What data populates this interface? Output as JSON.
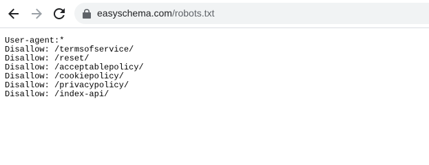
{
  "browser": {
    "icons": {
      "back": "arrow-left-icon",
      "forward": "arrow-right-icon",
      "reload": "reload-icon",
      "lock": "lock-icon"
    },
    "url_host": "easyschema.com",
    "url_path": "/robots.txt",
    "colors": {
      "omnibox_bg": "#f1f3f4",
      "icon_active": "#5f6368",
      "icon_disabled": "#9aa0a6"
    }
  },
  "document": {
    "lines": [
      "User-agent:*",
      "Disallow: /termsofservice/",
      "Disallow: /reset/",
      "Disallow: /acceptablepolicy/",
      "Disallow: /cookiepolicy/",
      "Disallow: /privacypolicy/",
      "Disallow: /index-api/"
    ]
  }
}
